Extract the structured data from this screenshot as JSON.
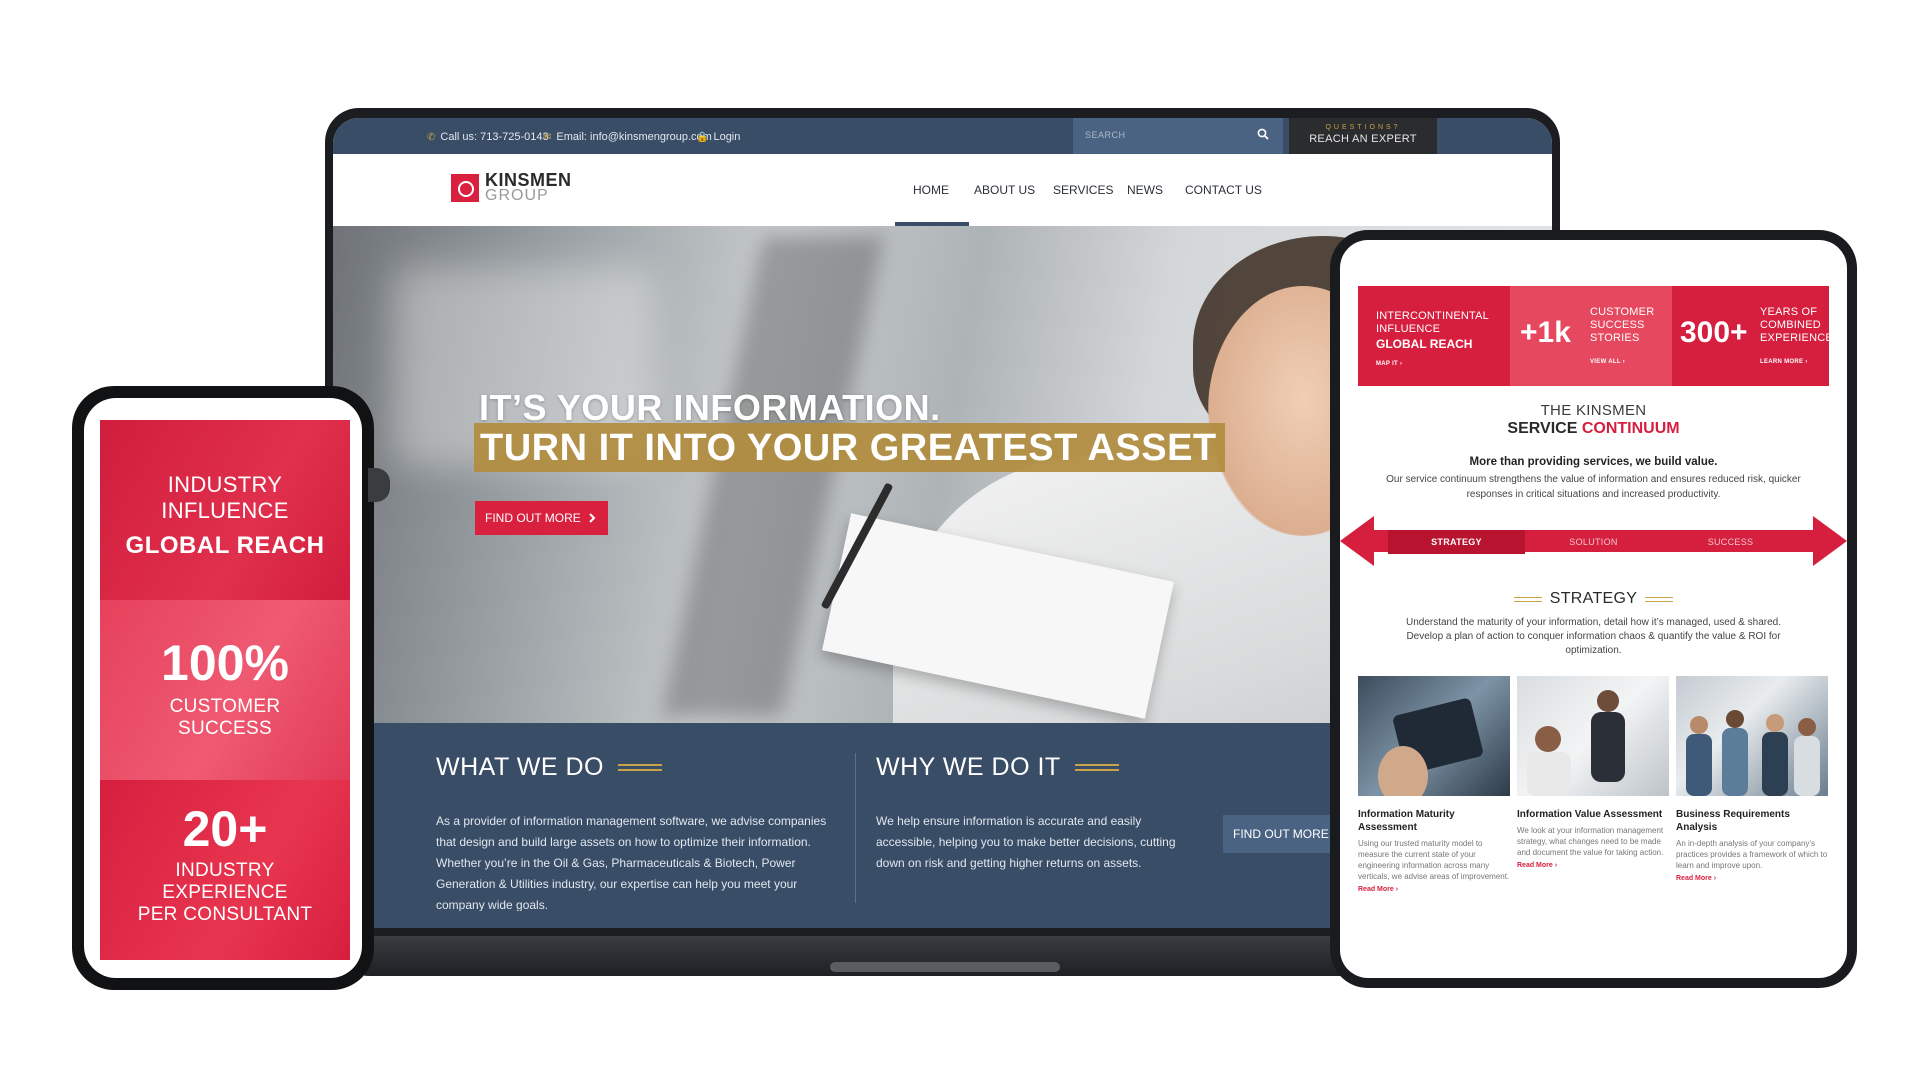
{
  "laptop": {
    "topbar": {
      "phone": "Call us: 713-725-0143",
      "email": "Email: info@kinsmengroup.com",
      "login": "Login",
      "search_placeholder": "SEARCH",
      "expert_kicker": "QUESTIONS?",
      "expert_label": "REACH AN EXPERT"
    },
    "logo": {
      "line1": "KINSMEN",
      "line2": "GROUP"
    },
    "nav": [
      "HOME",
      "ABOUT US",
      "SERVICES",
      "NEWS",
      "CONTACT US"
    ],
    "hero": {
      "line1": "IT’S YOUR INFORMATION.",
      "line2": "TURN IT INTO YOUR GREATEST ASSET",
      "cta": "FIND OUT MORE"
    },
    "what": {
      "title": "WHAT WE DO",
      "body": "As a provider of information management software, we advise companies that design and build large assets on how to optimize their information. Whether you’re in the Oil & Gas, Pharmaceuticals & Biotech, Power Generation & Utilities industry, our expertise can help you meet your company wide goals."
    },
    "why": {
      "title": "WHY WE DO IT",
      "body": "We help ensure information is accurate and easily accessible, helping you to make better decisions, cutting down on risk and getting higher returns on assets.",
      "cta": "FIND OUT MORE"
    }
  },
  "phone": {
    "panel1": {
      "light1": "INDUSTRY",
      "light2": "INFLUENCE",
      "bold": "GLOBAL REACH"
    },
    "panel2": {
      "big": "100%",
      "light1": "CUSTOMER",
      "light2": "SUCCESS"
    },
    "panel3": {
      "big": "20+",
      "light1": "INDUSTRY",
      "light2": "EXPERIENCE",
      "light3": "PER CONSULTANT"
    }
  },
  "tablet": {
    "stats": [
      {
        "l1": "INTERCONTINENTAL",
        "l2": "INFLUENCE",
        "bold": "GLOBAL REACH",
        "link": "MAP IT"
      },
      {
        "big": "+1k",
        "l1": "CUSTOMER",
        "l2": "SUCCESS",
        "l3": "STORIES",
        "link": "VIEW ALL"
      },
      {
        "big": "300+",
        "l1": "YEARS OF",
        "l2": "COMBINED",
        "l3": "EXPERIENCE",
        "link": "LEARN MORE"
      }
    ],
    "heading_light": "THE KINSMEN",
    "heading_bold": "SERVICE",
    "heading_red": "CONTINUUM",
    "lead": "More than providing services, we build value.",
    "para": "Our service continuum strengthens the value of information and ensures reduced risk, quicker responses in critical situations and increased productivity.",
    "tabs": [
      "STRATEGY",
      "SOLUTION",
      "SUCCESS"
    ],
    "section_title": "STRATEGY",
    "section_para": "Understand the maturity of your information, detail how it’s managed, used & shared. Develop a plan of action to conquer information chaos & quantify the value & ROI for optimization.",
    "cards": [
      {
        "title": "Information Maturity Assessment",
        "body": "Using our trusted maturity model to measure the current state of your engineering information across many verticals, we advise areas of improvement.",
        "more": "Read More"
      },
      {
        "title": "Information Value Assessment",
        "body": "We look at your information management strategy, what changes need to be made and document the value for taking action.",
        "more": "Read More"
      },
      {
        "title": "Business Requirements Analysis",
        "body": "An in-depth analysis of your company’s practices provides a framework of which to learn and improve upon.",
        "more": "Read More"
      }
    ]
  },
  "colors": {
    "brand_red": "#d61f3f",
    "navy": "#3a4d66",
    "gold": "#c9a24a"
  }
}
